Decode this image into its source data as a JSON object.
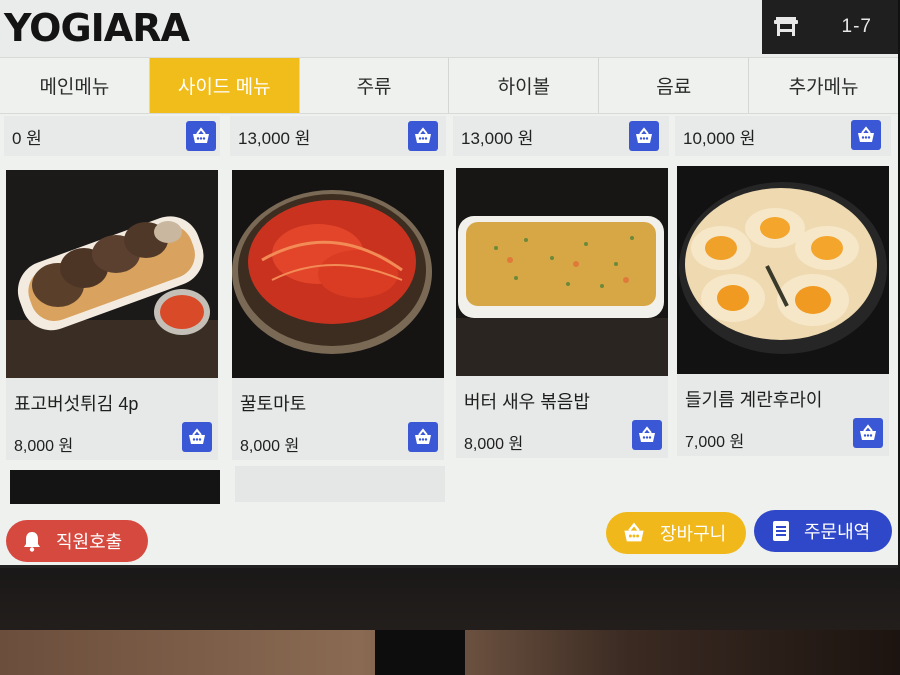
{
  "app": {
    "logo": "YOGIARA",
    "table_number": "1-7"
  },
  "colors": {
    "accent_yellow": "#f1bd1a",
    "basket_blue": "#3a57d6",
    "call_red": "#d6493f",
    "orders_blue": "#2f47c9"
  },
  "tabs": [
    {
      "label": "메인메뉴",
      "active": false
    },
    {
      "label": "사이드 메뉴",
      "active": true
    },
    {
      "label": "주류",
      "active": false
    },
    {
      "label": "하이볼",
      "active": false
    },
    {
      "label": "음료",
      "active": false
    },
    {
      "label": "추가메뉴",
      "active": false
    }
  ],
  "previous_row_prices": [
    "0 원",
    "13,000 원",
    "13,000 원",
    "10,000 원"
  ],
  "products": [
    {
      "name": "표고버섯튀김 4p",
      "price": "8,000 원",
      "icon": "basket-icon"
    },
    {
      "name": "꿀토마토",
      "price": "8,000 원",
      "icon": "basket-icon"
    },
    {
      "name": "버터 새우 볶음밥",
      "price": "8,000 원",
      "icon": "basket-icon"
    },
    {
      "name": "들기름 계란후라이",
      "price": "7,000 원",
      "icon": "basket-icon"
    }
  ],
  "bottom": {
    "call_staff": "직원호출",
    "cart": "장바구니",
    "orders": "주문내역"
  }
}
